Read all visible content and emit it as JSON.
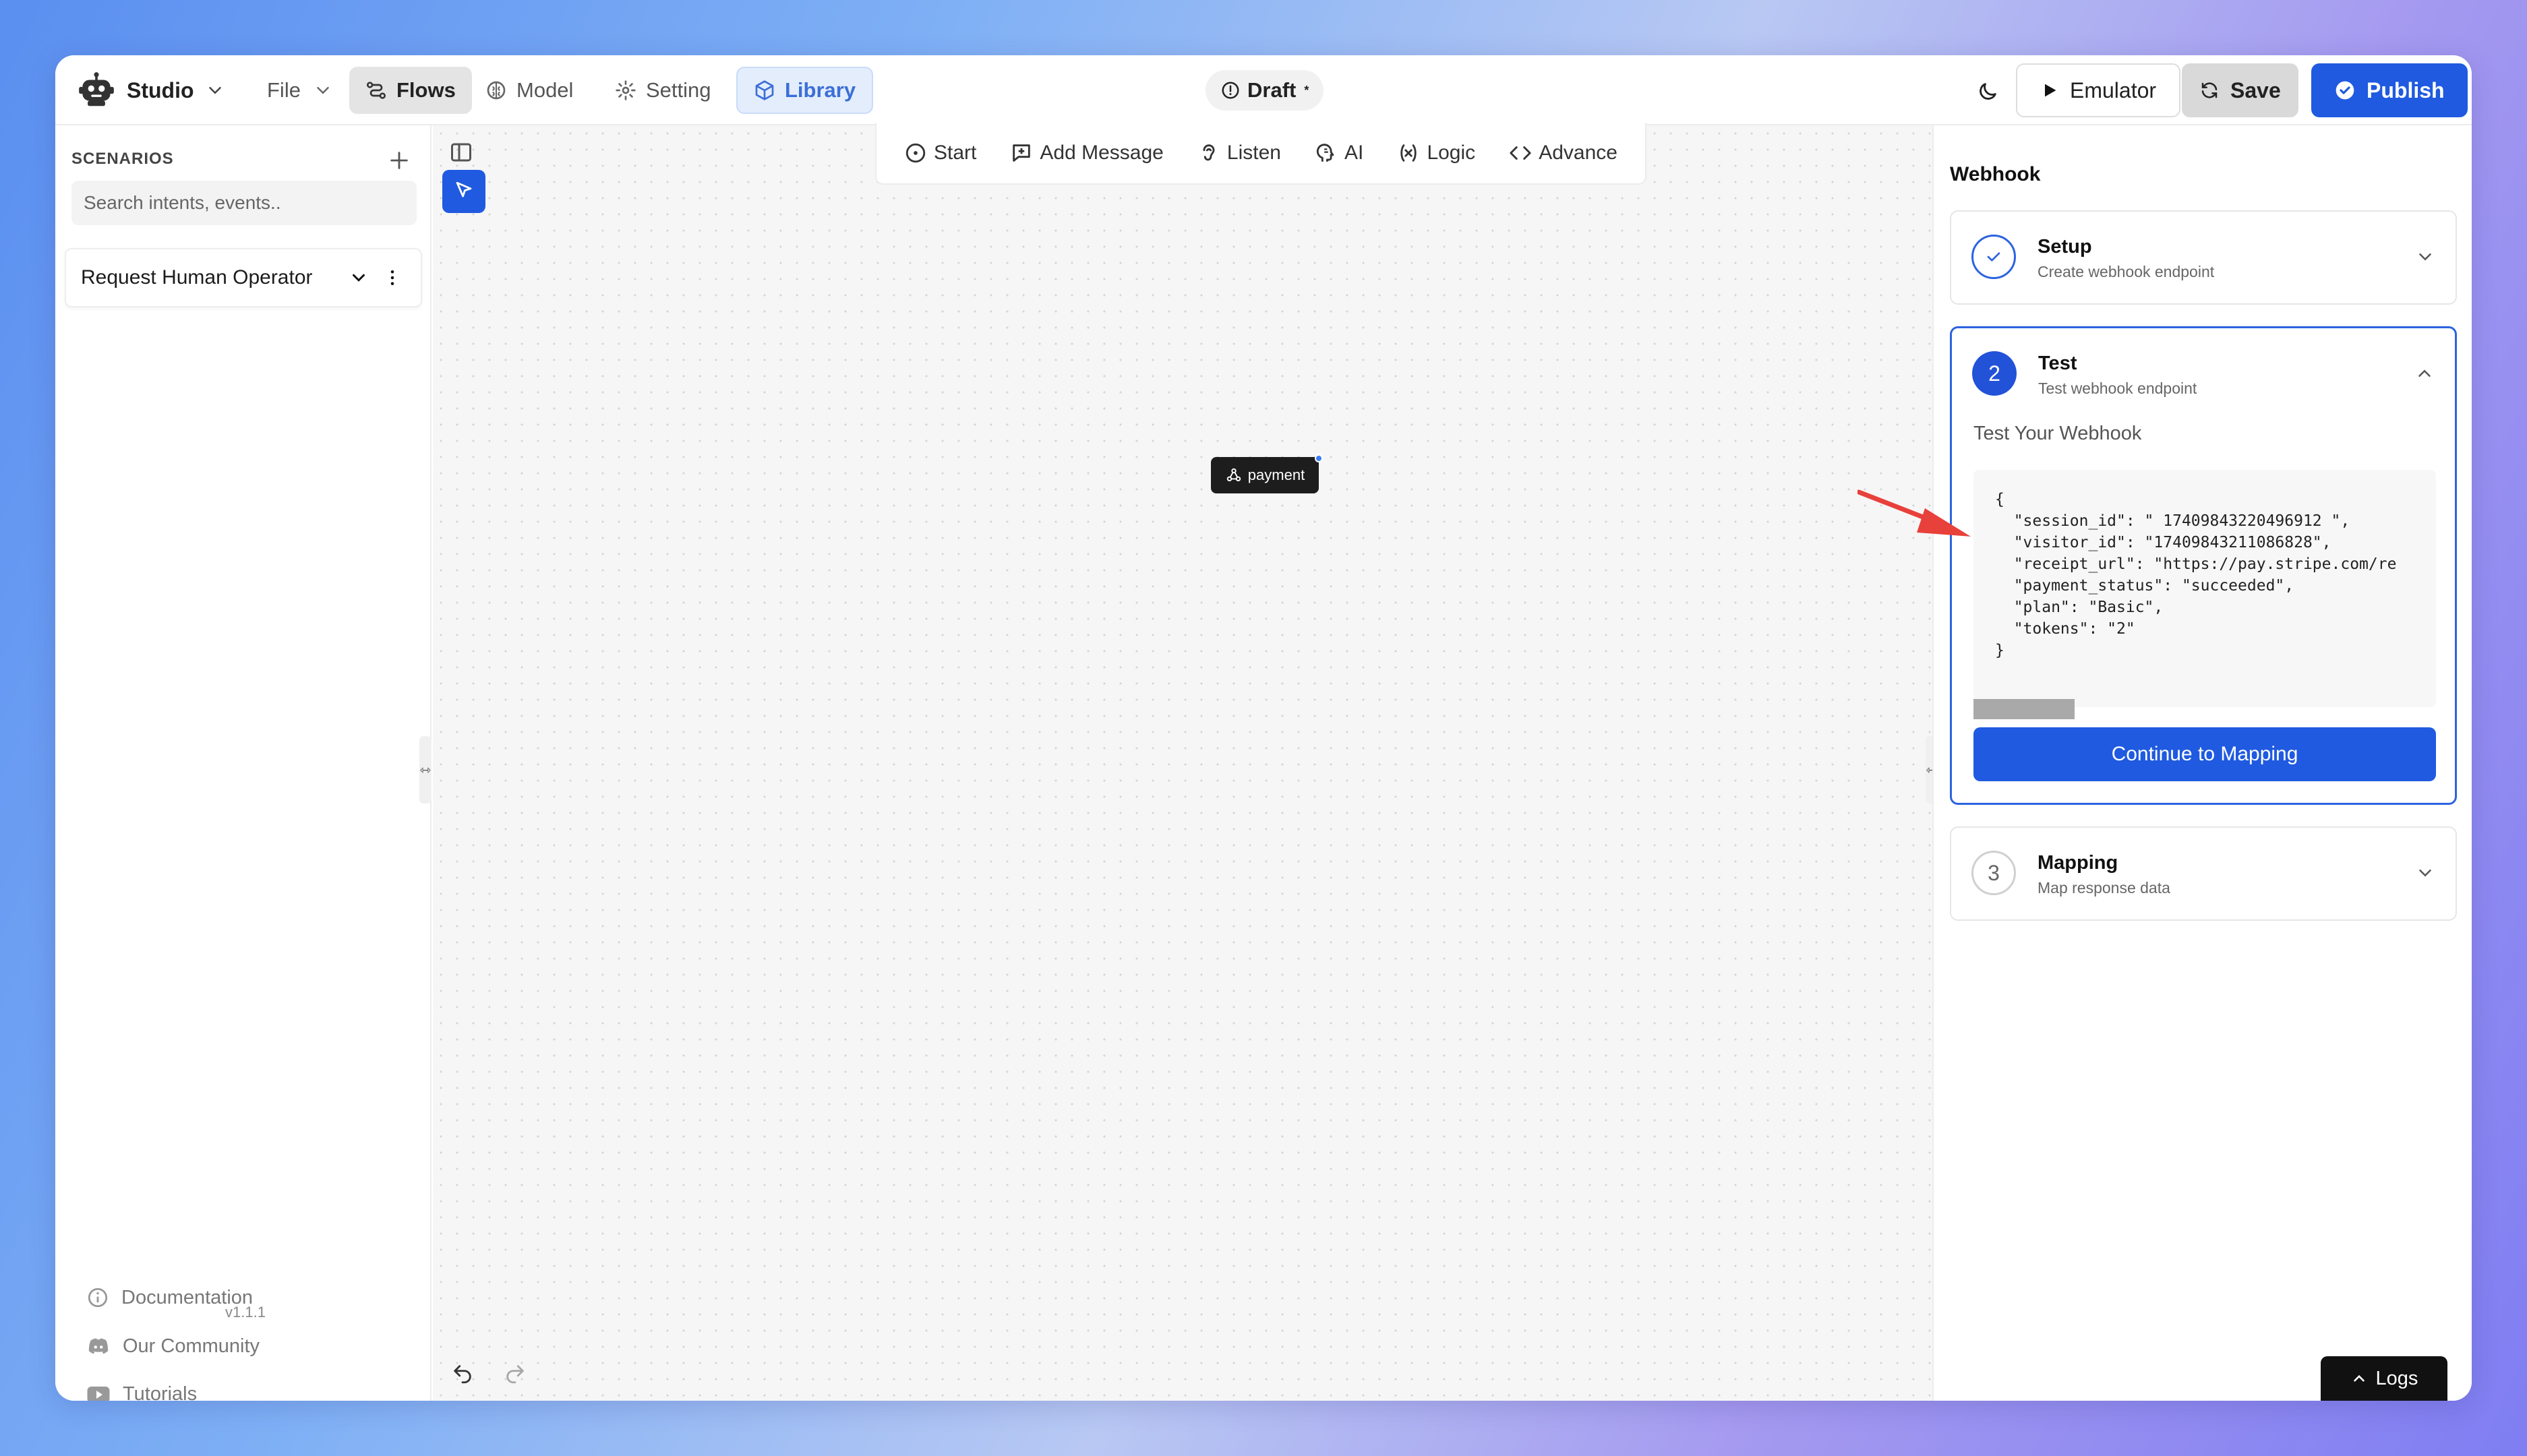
{
  "topbar": {
    "brand": "Studio",
    "file_label": "File",
    "nav": {
      "flows": "Flows",
      "model": "Model",
      "setting": "Setting",
      "library": "Library"
    },
    "draft_label": "Draft",
    "draft_mark": "*",
    "emulator_label": "Emulator",
    "save_label": "Save",
    "publish_label": "Publish"
  },
  "sidebar": {
    "title": "SCENARIOS",
    "search_placeholder": "Search intents, events..",
    "scenario_label": "Request Human Operator",
    "links": {
      "documentation": "Documentation",
      "community": "Our Community",
      "tutorials": "Tutorials"
    },
    "version": "v1.1.1"
  },
  "toolbar": {
    "start": "Start",
    "add_message": "Add Message",
    "listen": "Listen",
    "ai": "AI",
    "logic": "Logic",
    "advance": "Advance"
  },
  "canvas": {
    "node_label": "payment"
  },
  "panel": {
    "title": "Webhook",
    "steps": [
      {
        "title": "Setup",
        "subtitle": "Create webhook endpoint",
        "number": ""
      },
      {
        "title": "Test",
        "subtitle": "Test webhook endpoint",
        "number": "2"
      },
      {
        "title": "Mapping",
        "subtitle": "Map response data",
        "number": "3"
      }
    ],
    "test_heading": "Test Your Webhook",
    "code": "{\n  \"session_id\": \" 17409843220496912 \",\n  \"visitor_id\": \"17409843211086828\",\n  \"receipt_url\": \"https://pay.stripe.com/re\n  \"payment_status\": \"succeeded\",\n  \"plan\": \"Basic\",\n  \"tokens\": \"2\"\n}",
    "continue_label": "Continue to Mapping"
  },
  "logs_label": "Logs",
  "colors": {
    "accent": "#1f5ae0",
    "arrow": "#e8403a"
  }
}
